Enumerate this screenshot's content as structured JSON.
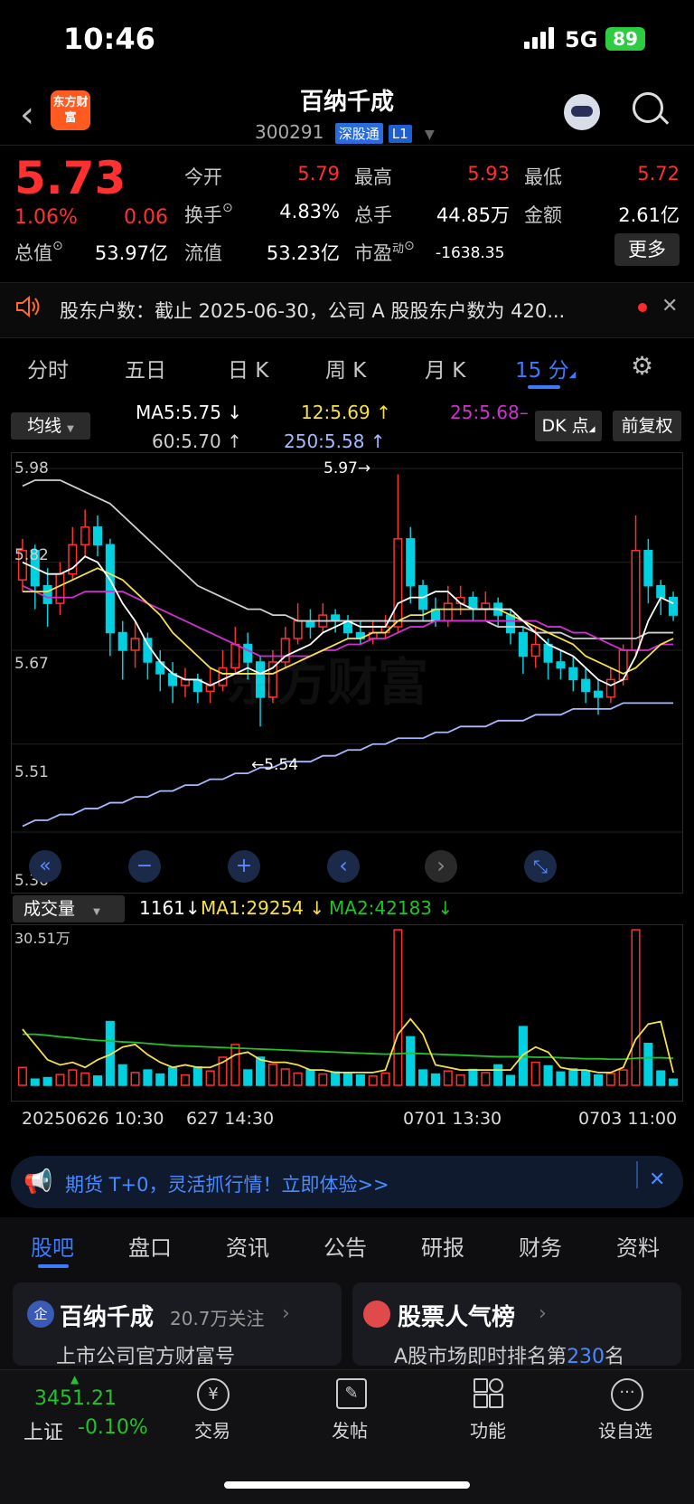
{
  "status_bar": {
    "time": "10:46",
    "network": "5G",
    "battery": "89"
  },
  "header": {
    "logo_text": "东方财富",
    "stock_name": "百纳千成",
    "code": "300291",
    "connect_tag": "深股通",
    "level_tag": "L1"
  },
  "quote": {
    "price": "5.73",
    "change_pct": "1.06%",
    "change_val": "0.06",
    "open_label": "今开",
    "open": "5.79",
    "high_label": "最高",
    "high": "5.93",
    "low_label": "最低",
    "low": "5.72",
    "turnover_label": "换手",
    "turnover": "4.83%",
    "volume_label": "总手",
    "volume": "44.85万",
    "amount_label": "金额",
    "amount": "2.61亿",
    "mktcap_label": "总值",
    "mktcap": "53.97亿",
    "float_label": "流值",
    "float": "53.23亿",
    "pe_label": "市盈",
    "pe_sup": "动",
    "pe": "-1638.35",
    "more_button": "更多"
  },
  "ticker": {
    "text": "股东户数：截止 2025-06-30，公司 A 股股东户数为 420..."
  },
  "chart_tabs": [
    "分时",
    "五日",
    "日 K",
    "周 K",
    "月 K",
    "15 分"
  ],
  "chart_tabs_active": 5,
  "indicator_bar": {
    "selector": "均线",
    "ma5": "MA5:5.75",
    "ma12": "12:5.69",
    "ma25": "25:5.68",
    "ma60": "60:5.70",
    "ma250": "250:5.58",
    "dk_button": "DK 点",
    "fq_button": "前复权",
    "colors": {
      "ma5": "#ffffff",
      "ma12": "#f5e04a",
      "ma25": "#d030d0",
      "ma60": "#cfcfcf",
      "ma250": "#a8b8ff"
    }
  },
  "price_axis": [
    "5.98",
    "5.82",
    "5.67",
    "5.51",
    "5.36"
  ],
  "price_markers": {
    "high": "5.97→",
    "low": "←5.54"
  },
  "watermark": "东方财富",
  "volume_bar": {
    "selector": "成交量",
    "current": "1161",
    "ma1": "MA1:29254",
    "ma2": "MA2:42183",
    "axis_max": "30.51万",
    "colors": {
      "ma1": "#f5e04a",
      "ma2": "#22c22a"
    }
  },
  "time_axis": [
    "20250626 10:30",
    "627 14:30",
    "0701 13:30",
    "0703 11:00"
  ],
  "chart_data": {
    "type": "candlestick",
    "ylim": [
      5.36,
      5.98
    ],
    "up_color": "#ff3030",
    "down_color": "#00d0e0",
    "candles": [
      [
        5.79,
        5.84,
        5.86,
        5.77
      ],
      [
        5.84,
        5.78,
        5.85,
        5.74
      ],
      [
        5.78,
        5.75,
        5.81,
        5.71
      ],
      [
        5.75,
        5.8,
        5.82,
        5.73
      ],
      [
        5.8,
        5.85,
        5.88,
        5.79
      ],
      [
        5.85,
        5.88,
        5.91,
        5.83
      ],
      [
        5.88,
        5.85,
        5.9,
        5.83
      ],
      [
        5.85,
        5.7,
        5.86,
        5.66
      ],
      [
        5.7,
        5.67,
        5.72,
        5.62
      ],
      [
        5.67,
        5.69,
        5.72,
        5.64
      ],
      [
        5.69,
        5.65,
        5.7,
        5.62
      ],
      [
        5.65,
        5.63,
        5.67,
        5.6
      ],
      [
        5.63,
        5.61,
        5.65,
        5.58
      ],
      [
        5.61,
        5.62,
        5.64,
        5.59
      ],
      [
        5.62,
        5.6,
        5.63,
        5.58
      ],
      [
        5.6,
        5.61,
        5.64,
        5.58
      ],
      [
        5.61,
        5.64,
        5.67,
        5.6
      ],
      [
        5.64,
        5.68,
        5.71,
        5.63
      ],
      [
        5.68,
        5.65,
        5.7,
        5.62
      ],
      [
        5.65,
        5.59,
        5.66,
        5.54
      ],
      [
        5.59,
        5.65,
        5.67,
        5.58
      ],
      [
        5.65,
        5.69,
        5.71,
        5.64
      ],
      [
        5.69,
        5.72,
        5.75,
        5.68
      ],
      [
        5.72,
        5.71,
        5.74,
        5.69
      ],
      [
        5.71,
        5.73,
        5.75,
        5.7
      ],
      [
        5.73,
        5.72,
        5.74,
        5.7
      ],
      [
        5.72,
        5.7,
        5.73,
        5.69
      ],
      [
        5.7,
        5.69,
        5.72,
        5.68
      ],
      [
        5.69,
        5.7,
        5.72,
        5.68
      ],
      [
        5.7,
        5.71,
        5.73,
        5.69
      ],
      [
        5.71,
        5.86,
        5.97,
        5.7
      ],
      [
        5.86,
        5.78,
        5.88,
        5.75
      ],
      [
        5.78,
        5.74,
        5.79,
        5.72
      ],
      [
        5.74,
        5.72,
        5.76,
        5.71
      ],
      [
        5.72,
        5.75,
        5.78,
        5.71
      ],
      [
        5.75,
        5.76,
        5.78,
        5.73
      ],
      [
        5.76,
        5.74,
        5.77,
        5.72
      ],
      [
        5.74,
        5.75,
        5.77,
        5.72
      ],
      [
        5.75,
        5.73,
        5.76,
        5.71
      ],
      [
        5.73,
        5.7,
        5.74,
        5.68
      ],
      [
        5.7,
        5.66,
        5.71,
        5.63
      ],
      [
        5.66,
        5.68,
        5.71,
        5.64
      ],
      [
        5.68,
        5.65,
        5.69,
        5.62
      ],
      [
        5.65,
        5.64,
        5.67,
        5.62
      ],
      [
        5.64,
        5.62,
        5.66,
        5.6
      ],
      [
        5.62,
        5.6,
        5.64,
        5.58
      ],
      [
        5.6,
        5.59,
        5.62,
        5.56
      ],
      [
        5.59,
        5.62,
        5.64,
        5.58
      ],
      [
        5.62,
        5.67,
        5.68,
        5.61
      ],
      [
        5.67,
        5.84,
        5.9,
        5.66
      ],
      [
        5.84,
        5.78,
        5.86,
        5.75
      ],
      [
        5.78,
        5.76,
        5.79,
        5.73
      ],
      [
        5.76,
        5.73,
        5.77,
        5.72
      ]
    ],
    "ma5": [
      5.82,
      5.81,
      5.8,
      5.8,
      5.81,
      5.83,
      5.82,
      5.79,
      5.75,
      5.72,
      5.68,
      5.65,
      5.63,
      5.62,
      5.62,
      5.61,
      5.62,
      5.63,
      5.64,
      5.63,
      5.64,
      5.66,
      5.67,
      5.68,
      5.7,
      5.71,
      5.72,
      5.71,
      5.71,
      5.71,
      5.75,
      5.76,
      5.76,
      5.77,
      5.77,
      5.75,
      5.74,
      5.74,
      5.74,
      5.74,
      5.72,
      5.7,
      5.68,
      5.67,
      5.66,
      5.64,
      5.62,
      5.61,
      5.62,
      5.66,
      5.72,
      5.76,
      5.75
    ],
    "ma12": [
      5.77,
      5.77,
      5.77,
      5.78,
      5.79,
      5.8,
      5.81,
      5.8,
      5.79,
      5.77,
      5.75,
      5.73,
      5.7,
      5.68,
      5.66,
      5.64,
      5.63,
      5.63,
      5.63,
      5.63,
      5.63,
      5.64,
      5.65,
      5.66,
      5.67,
      5.68,
      5.69,
      5.69,
      5.7,
      5.7,
      5.72,
      5.73,
      5.73,
      5.74,
      5.74,
      5.74,
      5.74,
      5.74,
      5.74,
      5.73,
      5.72,
      5.71,
      5.7,
      5.69,
      5.68,
      5.66,
      5.65,
      5.64,
      5.63,
      5.64,
      5.66,
      5.68,
      5.69
    ],
    "ma25": [
      5.78,
      5.77,
      5.76,
      5.76,
      5.76,
      5.77,
      5.77,
      5.77,
      5.77,
      5.76,
      5.75,
      5.74,
      5.73,
      5.72,
      5.71,
      5.7,
      5.69,
      5.68,
      5.67,
      5.66,
      5.66,
      5.66,
      5.66,
      5.66,
      5.67,
      5.67,
      5.68,
      5.68,
      5.69,
      5.69,
      5.7,
      5.71,
      5.71,
      5.72,
      5.72,
      5.72,
      5.72,
      5.72,
      5.72,
      5.72,
      5.72,
      5.72,
      5.71,
      5.71,
      5.7,
      5.7,
      5.69,
      5.68,
      5.67,
      5.67,
      5.67,
      5.68,
      5.68
    ],
    "ma60": [
      5.95,
      5.96,
      5.96,
      5.96,
      5.95,
      5.94,
      5.93,
      5.92,
      5.9,
      5.88,
      5.86,
      5.84,
      5.82,
      5.8,
      5.78,
      5.77,
      5.76,
      5.75,
      5.74,
      5.74,
      5.73,
      5.73,
      5.72,
      5.72,
      5.72,
      5.72,
      5.72,
      5.72,
      5.72,
      5.72,
      5.72,
      5.72,
      5.72,
      5.72,
      5.72,
      5.72,
      5.72,
      5.72,
      5.71,
      5.71,
      5.71,
      5.7,
      5.7,
      5.7,
      5.69,
      5.69,
      5.69,
      5.69,
      5.69,
      5.69,
      5.7,
      5.7,
      5.7
    ],
    "ma250": [
      5.37,
      5.38,
      5.38,
      5.39,
      5.39,
      5.4,
      5.4,
      5.41,
      5.41,
      5.42,
      5.42,
      5.43,
      5.43,
      5.44,
      5.44,
      5.45,
      5.45,
      5.46,
      5.46,
      5.47,
      5.47,
      5.48,
      5.48,
      5.48,
      5.49,
      5.49,
      5.5,
      5.5,
      5.51,
      5.51,
      5.52,
      5.52,
      5.52,
      5.53,
      5.53,
      5.54,
      5.54,
      5.54,
      5.55,
      5.55,
      5.55,
      5.56,
      5.56,
      5.56,
      5.57,
      5.57,
      5.57,
      5.57,
      5.58,
      5.58,
      5.58,
      5.58,
      5.58
    ],
    "volume": [
      3.5,
      1.2,
      1.5,
      2.1,
      3.0,
      2.4,
      1.8,
      12.5,
      4.0,
      2.5,
      3.0,
      2.2,
      3.4,
      2.0,
      3.6,
      2.8,
      5.5,
      8.0,
      3.0,
      5.5,
      4.1,
      3.2,
      2.4,
      3.0,
      2.2,
      2.6,
      2.5,
      2.0,
      1.8,
      2.4,
      30.5,
      9.5,
      3.0,
      2.2,
      2.8,
      2.0,
      3.1,
      2.5,
      4.0,
      1.9,
      11.5,
      4.5,
      3.8,
      2.6,
      3.2,
      2.7,
      2.0,
      2.3,
      3.0,
      30.5,
      8.2,
      2.8,
      1.2
    ],
    "vol_ma1": [
      11.0,
      8.0,
      5.0,
      4.0,
      4.5,
      3.5,
      5.0,
      6.0,
      7.5,
      8.0,
      6.0,
      4.5,
      3.5,
      4.0,
      3.5,
      3.5,
      4.5,
      6.0,
      6.5,
      5.0,
      4.5,
      4.5,
      4.0,
      3.0,
      3.0,
      2.5,
      2.5,
      2.5,
      2.5,
      3.0,
      10.0,
      13.0,
      10.0,
      4.0,
      3.5,
      3.0,
      3.0,
      3.0,
      3.0,
      3.0,
      6.0,
      7.5,
      6.5,
      3.5,
      3.0,
      3.0,
      2.5,
      2.5,
      3.5,
      9.0,
      12.0,
      12.5,
      2.5
    ],
    "vol_ma2": [
      10.0,
      10.0,
      9.8,
      9.5,
      9.3,
      9.0,
      8.8,
      8.7,
      8.5,
      8.4,
      8.2,
      8.0,
      7.8,
      7.7,
      7.6,
      7.5,
      7.4,
      7.3,
      7.2,
      7.1,
      7.0,
      6.9,
      6.8,
      6.7,
      6.6,
      6.5,
      6.4,
      6.3,
      6.2,
      6.1,
      6.2,
      6.3,
      6.2,
      6.1,
      6.0,
      5.9,
      5.8,
      5.7,
      5.6,
      5.6,
      5.6,
      5.5,
      5.5,
      5.4,
      5.3,
      5.2,
      5.2,
      5.1,
      5.1,
      5.3,
      5.4,
      5.4,
      5.3
    ],
    "vol_ylim": [
      0,
      30.51
    ]
  },
  "chart_controls": [
    "«",
    "−",
    "+",
    "‹",
    "›",
    "⤡"
  ],
  "promo": {
    "text": "期货 T+0，灵活抓行情！立即体验>>"
  },
  "bottom_tabs": [
    "股吧",
    "盘口",
    "资讯",
    "公告",
    "研报",
    "财务",
    "资料"
  ],
  "bottom_tabs_active": 0,
  "cards": {
    "left": {
      "badge": "企",
      "title": "百纳千成",
      "follow": "20.7万关注",
      "sub": "上市公司官方财富号"
    },
    "right": {
      "title": "股票人气榜",
      "sub_pre": "A股市场即时排名第",
      "rank": "230",
      "sub_post": "名"
    }
  },
  "bottom_nav": {
    "index_value": "3451.21",
    "index_name": "上证",
    "index_change": "-0.10%",
    "items": [
      "交易",
      "发帖",
      "功能",
      "设自选"
    ]
  }
}
